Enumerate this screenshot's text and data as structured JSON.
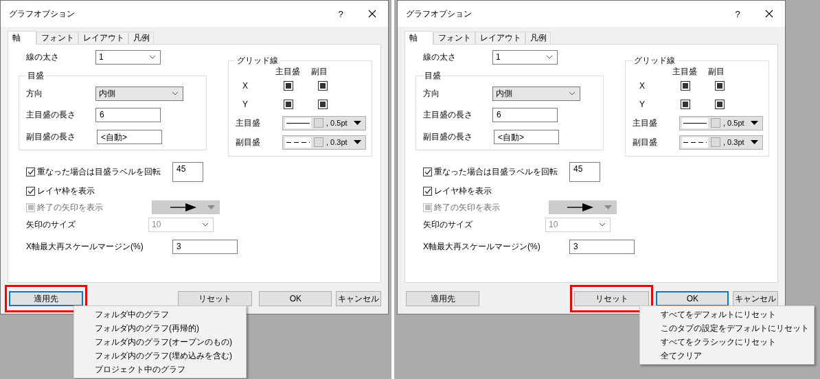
{
  "dialogs": [
    {
      "title": "グラフオプション",
      "help": "?",
      "tabs": [
        {
          "label": "軸",
          "selected": true
        },
        {
          "label": "フォント",
          "selected": false
        },
        {
          "label": "レイアウト",
          "selected": false
        },
        {
          "label": "凡例",
          "selected": false
        }
      ],
      "line_width": {
        "label": "線の太さ",
        "value": "1"
      },
      "ticks": {
        "title": "目盛",
        "direction": {
          "label": "方向",
          "value": "内側"
        },
        "major_length": {
          "label": "主目盛の長さ",
          "value": "6"
        },
        "minor_length": {
          "label": "副目盛の長さ",
          "value": "<自動>"
        }
      },
      "grid": {
        "title": "グリッド線",
        "columns": [
          "主目盛",
          "副目"
        ],
        "rows": [
          {
            "label": "X",
            "major": true,
            "minor": true
          },
          {
            "label": "Y",
            "major": true,
            "minor": true
          }
        ],
        "lines": [
          {
            "label": "主目盛",
            "width": ", 0.5pt"
          },
          {
            "label": "副目盛",
            "width": ", 0.3pt"
          }
        ]
      },
      "rotate": {
        "label": "重なった場合は目盛ラベルを回転",
        "checked": true,
        "value": "45"
      },
      "frame": {
        "label": "レイヤ枠を表示",
        "checked": true
      },
      "end_arrow": {
        "label": "終了の矢印を表示",
        "checked": true,
        "disabled": true
      },
      "arrow_size": {
        "label": "矢印のサイズ",
        "value": "10",
        "disabled": true
      },
      "margin": {
        "label": "X軸最大再スケールマージン(%)",
        "value": "3"
      },
      "buttons": [
        {
          "label": "適用先",
          "focused": true,
          "highlighted": true
        },
        {
          "label": "リセット",
          "focused": false,
          "highlighted": false
        },
        {
          "label": "OK",
          "focused": false,
          "highlighted": false
        },
        {
          "label": "キャンセル",
          "focused": false,
          "highlighted": false
        }
      ],
      "menu": {
        "items": [
          "フォルダ中のグラフ",
          "フォルダ内のグラフ(再帰的)",
          "フォルダ内のグラフ(オープンのもの)",
          "フォルダ内のグラフ(埋め込みを含む)",
          "プロジェクト中のグラフ"
        ]
      }
    },
    {
      "title": "グラフオプション",
      "help": "?",
      "tabs": [
        {
          "label": "軸",
          "selected": true
        },
        {
          "label": "フォント",
          "selected": false
        },
        {
          "label": "レイアウト",
          "selected": false
        },
        {
          "label": "凡例",
          "selected": false
        }
      ],
      "line_width": {
        "label": "線の太さ",
        "value": "1"
      },
      "ticks": {
        "title": "目盛",
        "direction": {
          "label": "方向",
          "value": "内側"
        },
        "major_length": {
          "label": "主目盛の長さ",
          "value": "6"
        },
        "minor_length": {
          "label": "副目盛の長さ",
          "value": "<自動>"
        }
      },
      "grid": {
        "title": "グリッド線",
        "columns": [
          "主目盛",
          "副目"
        ],
        "rows": [
          {
            "label": "X",
            "major": true,
            "minor": true
          },
          {
            "label": "Y",
            "major": true,
            "minor": true
          }
        ],
        "lines": [
          {
            "label": "主目盛",
            "width": ", 0.5pt"
          },
          {
            "label": "副目盛",
            "width": ", 0.3pt"
          }
        ]
      },
      "rotate": {
        "label": "重なった場合は目盛ラベルを回転",
        "checked": true,
        "value": "45"
      },
      "frame": {
        "label": "レイヤ枠を表示",
        "checked": true
      },
      "end_arrow": {
        "label": "終了の矢印を表示",
        "checked": true,
        "disabled": true
      },
      "arrow_size": {
        "label": "矢印のサイズ",
        "value": "10",
        "disabled": true
      },
      "margin": {
        "label": "X軸最大再スケールマージン(%)",
        "value": "3"
      },
      "buttons": [
        {
          "label": "適用先",
          "focused": false,
          "highlighted": false
        },
        {
          "label": "リセット",
          "focused": false,
          "highlighted": true
        },
        {
          "label": "OK",
          "focused": true,
          "highlighted": false
        },
        {
          "label": "キャンセル",
          "focused": false,
          "highlighted": false
        }
      ],
      "menu": {
        "items": [
          "すべてをデフォルトにリセット",
          "このタブの設定をデフォルトにリセット",
          "すべてをクラシックにリセット",
          "全てクリア"
        ]
      }
    }
  ]
}
